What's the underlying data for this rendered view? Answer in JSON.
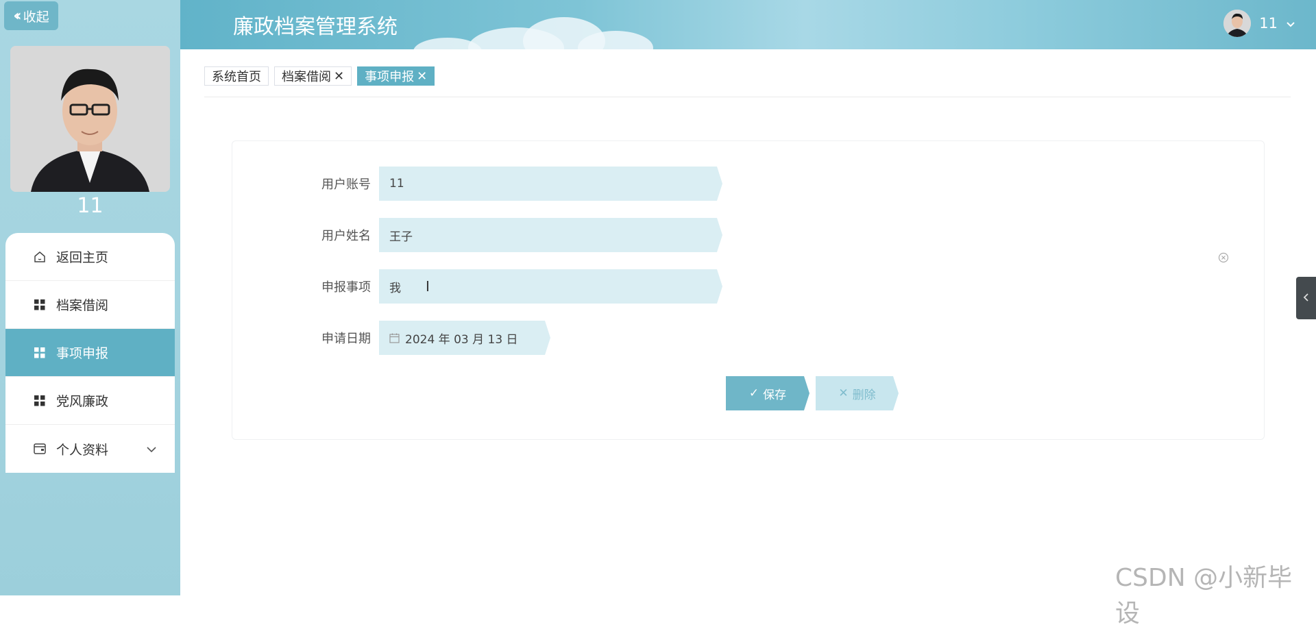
{
  "sidebar": {
    "collapse_label": "收起",
    "username": "11",
    "menu": [
      {
        "label": "返回主页",
        "icon": "home-icon"
      },
      {
        "label": "档案借阅",
        "icon": "grid-icon"
      },
      {
        "label": "事项申报",
        "icon": "grid-icon",
        "active": true
      },
      {
        "label": "党风廉政",
        "icon": "grid-icon"
      },
      {
        "label": "个人资料",
        "icon": "wallet-icon",
        "has_submenu": true
      }
    ]
  },
  "header": {
    "title": "廉政档案管理系统",
    "user": "11"
  },
  "tabs": [
    {
      "label": "系统首页",
      "closable": false
    },
    {
      "label": "档案借阅",
      "closable": true
    },
    {
      "label": "事项申报",
      "closable": true,
      "active": true
    }
  ],
  "form": {
    "account": {
      "label": "用户账号",
      "value": "11"
    },
    "name": {
      "label": "用户姓名",
      "value": "王子"
    },
    "matter": {
      "label": "申报事项",
      "value": "我"
    },
    "date": {
      "label": "申请日期",
      "value": "2024 年 03 月 13 日"
    },
    "save_label": "保存",
    "delete_label": "删除"
  },
  "watermark": "CSDN @小新毕设",
  "colors": {
    "accent": "#5fb0c4",
    "sidebar_bg": "#a9d7e2",
    "field_bg": "#daeef3"
  }
}
